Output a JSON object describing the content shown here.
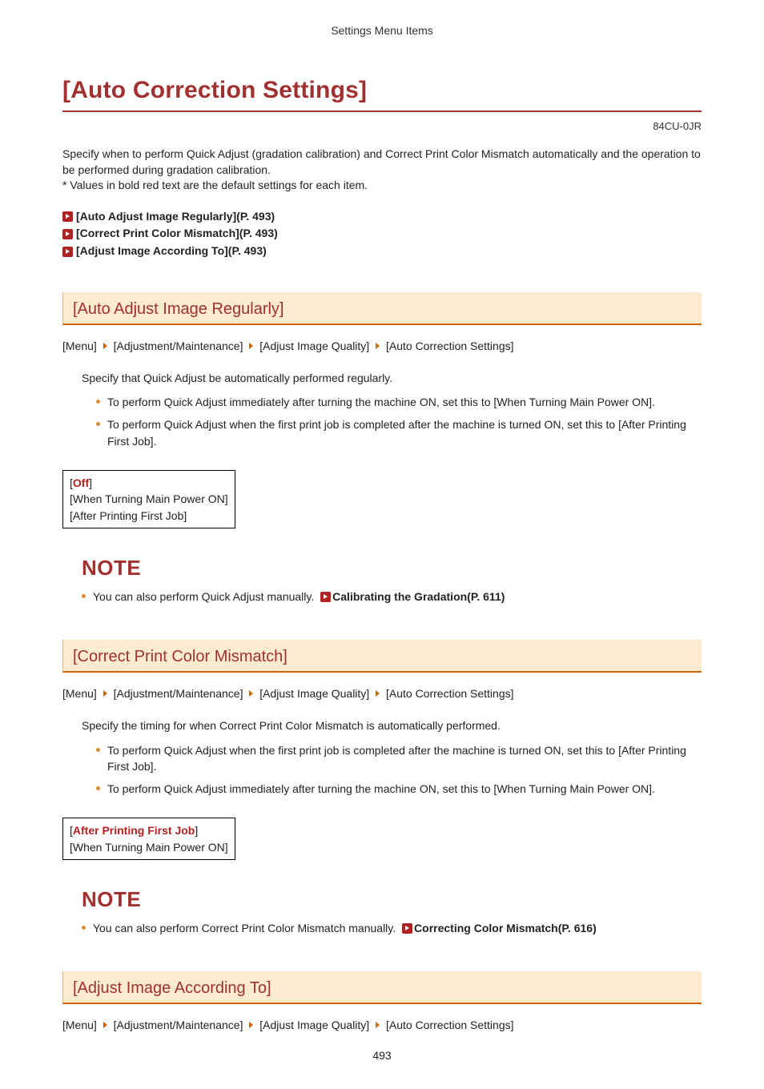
{
  "header": {
    "title": "Settings Menu Items"
  },
  "page_title": "[Auto Correction Settings]",
  "doc_id": "84CU-0JR",
  "intro_p1": "Specify when to perform Quick Adjust (gradation calibration) and Correct Print Color Mismatch automatically and the operation to be performed during gradation calibration.",
  "intro_p2": "* Values in bold red text are the default settings for each item.",
  "toc": [
    "[Auto Adjust Image Regularly](P. 493)",
    "[Correct Print Color Mismatch](P. 493)",
    "[Adjust Image According To](P. 493)"
  ],
  "breadcrumb": {
    "items": [
      "[Menu]",
      "[Adjustment/Maintenance]",
      "[Adjust Image Quality]",
      "[Auto Correction Settings]"
    ]
  },
  "note_label": "NOTE",
  "section1": {
    "heading": "[Auto Adjust Image Regularly]",
    "lead": "Specify that Quick Adjust be automatically performed regularly.",
    "bullets": [
      "To perform Quick Adjust immediately after turning the machine ON, set this to [When Turning Main Power ON].",
      "To perform Quick Adjust when the first print job is completed after the machine is turned ON, set this to [After Printing First Job]."
    ],
    "options": {
      "default": "Off",
      "others": [
        "[When Turning Main Power ON]",
        "[After Printing First Job]"
      ]
    },
    "note_text": "You can also perform Quick Adjust manually. ",
    "note_link": "Calibrating the Gradation(P. 611)"
  },
  "section2": {
    "heading": "[Correct Print Color Mismatch]",
    "lead": "Specify the timing for when Correct Print Color Mismatch is automatically performed.",
    "bullets": [
      "To perform Quick Adjust when the first print job is completed after the machine is turned ON, set this to [After Printing First Job].",
      "To perform Quick Adjust immediately after turning the machine ON, set this to [When Turning Main Power ON]."
    ],
    "options": {
      "default": "After Printing First Job",
      "others": [
        "[When Turning Main Power ON]"
      ]
    },
    "note_text": "You can also perform Correct Print Color Mismatch manually. ",
    "note_link": "Correcting Color Mismatch(P. 616)"
  },
  "section3": {
    "heading": "[Adjust Image According To]"
  },
  "page_number": "493"
}
